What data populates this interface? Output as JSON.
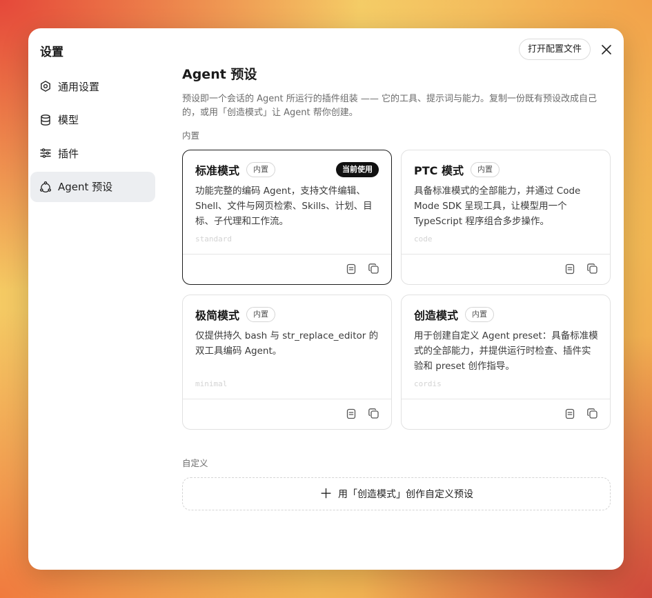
{
  "modal": {
    "title": "设置",
    "open_config_label": "打开配置文件"
  },
  "sidebar": {
    "items": [
      {
        "label": "通用设置",
        "icon": "gear-icon"
      },
      {
        "label": "模型",
        "icon": "database-icon"
      },
      {
        "label": "插件",
        "icon": "sliders-icon"
      },
      {
        "label": "Agent 预设",
        "icon": "recycle-icon",
        "active": true
      }
    ]
  },
  "main": {
    "title": "Agent 预设",
    "description": "预设即一个会话的 Agent 所运行的插件组装 —— 它的工具、提示词与能力。复制一份既有预设改成自己的，或用「创造模式」让 Agent 帮你创建。",
    "builtin_label": "内置",
    "custom_label": "自定义",
    "add_custom_label": "用「创造模式」创作自定义预设",
    "presets": [
      {
        "name": "标准模式",
        "badge": "内置",
        "current_badge": "当前使用",
        "description": "功能完整的编码 Agent，支持文件编辑、Shell、文件与网页检索、Skills、计划、目标、子代理和工作流。",
        "id": "standard"
      },
      {
        "name": "PTC 模式",
        "badge": "内置",
        "description": "具备标准模式的全部能力，并通过 Code Mode SDK 呈现工具，让模型用一个 TypeScript 程序组合多步操作。",
        "id": "code"
      },
      {
        "name": "极简模式",
        "badge": "内置",
        "description": "仅提供持久 bash 与 str_replace_editor 的双工具编码 Agent。",
        "id": "minimal"
      },
      {
        "name": "创造模式",
        "badge": "内置",
        "description": "用于创建自定义 Agent preset：具备标准模式的全部能力，并提供运行时检查、插件实验和 preset 创作指导。",
        "id": "cordis"
      }
    ]
  }
}
